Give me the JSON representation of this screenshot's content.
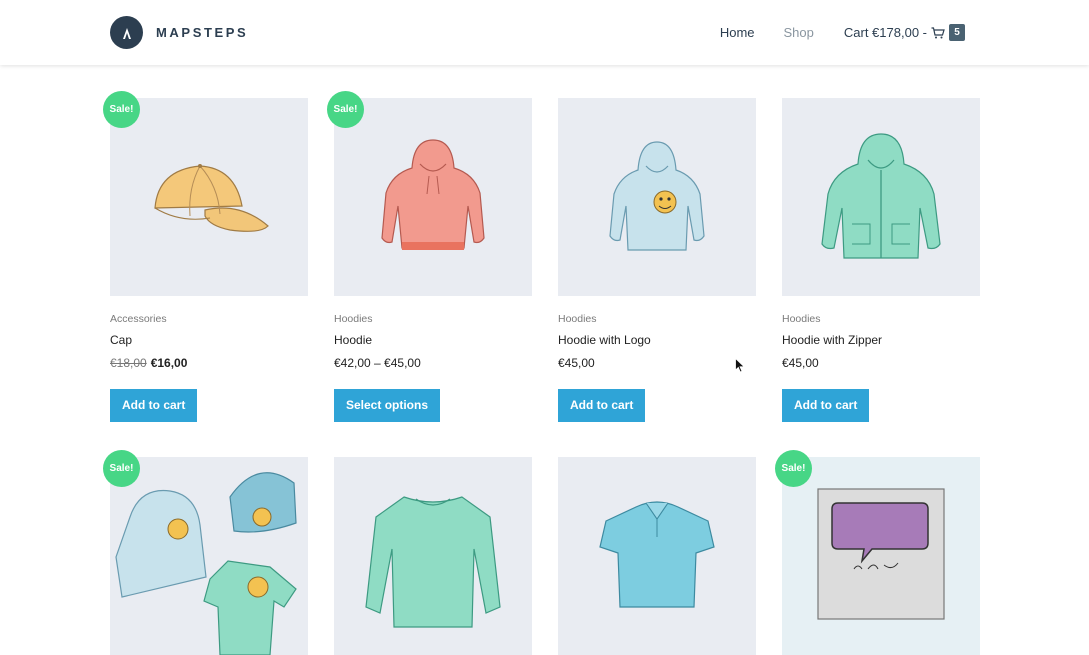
{
  "header": {
    "brand": "MAPSTEPS",
    "nav": {
      "home": "Home",
      "shop": "Shop",
      "cart": "Cart €178,00 -",
      "cart_count": "5"
    }
  },
  "products": [
    {
      "sale": "Sale!",
      "category": "Accessories",
      "title": "Cap",
      "price_old": "€18,00",
      "price": "€16,00",
      "button": "Add to cart",
      "image": "cap"
    },
    {
      "sale": "Sale!",
      "category": "Hoodies",
      "title": "Hoodie",
      "price": "€42,00 – €45,00",
      "button": "Select options",
      "image": "hoodie-red"
    },
    {
      "category": "Hoodies",
      "title": "Hoodie with Logo",
      "price": "€45,00",
      "button": "Add to cart",
      "image": "hoodie-logo"
    },
    {
      "category": "Hoodies",
      "title": "Hoodie with Zipper",
      "price": "€45,00",
      "button": "Add to cart",
      "image": "hoodie-zipper"
    },
    {
      "sale": "Sale!",
      "image": "clothing-set"
    },
    {
      "image": "long-sleeve-tee"
    },
    {
      "image": "polo"
    },
    {
      "sale": "Sale!",
      "image": "woo-single"
    }
  ],
  "colors": {
    "accent": "#2fa4d7",
    "sale": "#47d686",
    "brand": "#2c3e50"
  }
}
